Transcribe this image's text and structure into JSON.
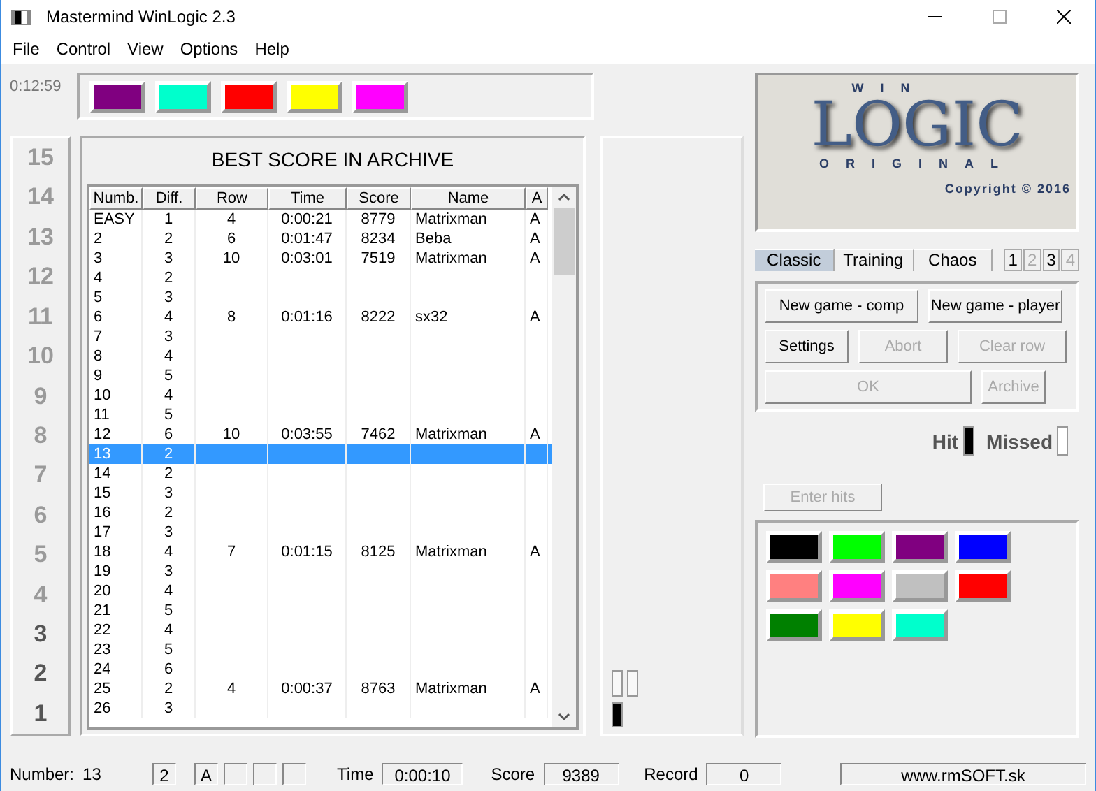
{
  "window": {
    "title": "Mastermind WinLogic 2.3"
  },
  "menu": [
    "File",
    "Control",
    "View",
    "Options",
    "Help"
  ],
  "timer": "0:12:59",
  "code": [
    {
      "color": "#800080"
    },
    {
      "color": "#00ffcc"
    },
    {
      "color": "#ff0000"
    },
    {
      "color": "#ffff00"
    },
    {
      "color": "#ff00ff"
    }
  ],
  "row_numbers": [
    {
      "label": "15",
      "active": false
    },
    {
      "label": "14",
      "active": false
    },
    {
      "label": "13",
      "active": false
    },
    {
      "label": "12",
      "active": false
    },
    {
      "label": "11",
      "active": false
    },
    {
      "label": "10",
      "active": false
    },
    {
      "label": "9",
      "active": false
    },
    {
      "label": "8",
      "active": false
    },
    {
      "label": "7",
      "active": false
    },
    {
      "label": "6",
      "active": false
    },
    {
      "label": "5",
      "active": false
    },
    {
      "label": "4",
      "active": false
    },
    {
      "label": "3",
      "active": true
    },
    {
      "label": "2",
      "active": true
    },
    {
      "label": "1",
      "active": true
    }
  ],
  "archive": {
    "title": "BEST SCORE IN ARCHIVE",
    "columns": [
      "Numb.",
      "Diff.",
      "Row",
      "Time",
      "Score",
      "Name",
      "A"
    ],
    "rows": [
      {
        "cells": [
          "EASY",
          "1",
          "4",
          "0:00:21",
          "8779",
          "Matrixman",
          "A"
        ],
        "selected": false
      },
      {
        "cells": [
          "2",
          "2",
          "6",
          "0:01:47",
          "8234",
          "Beba",
          "A"
        ],
        "selected": false
      },
      {
        "cells": [
          "3",
          "3",
          "10",
          "0:03:01",
          "7519",
          "Matrixman",
          "A"
        ],
        "selected": false
      },
      {
        "cells": [
          "4",
          "2"
        ],
        "selected": false
      },
      {
        "cells": [
          "5",
          "3"
        ],
        "selected": false
      },
      {
        "cells": [
          "6",
          "4",
          "8",
          "0:01:16",
          "8222",
          "sx32",
          "A"
        ],
        "selected": false
      },
      {
        "cells": [
          "7",
          "3"
        ],
        "selected": false
      },
      {
        "cells": [
          "8",
          "4"
        ],
        "selected": false
      },
      {
        "cells": [
          "9",
          "5"
        ],
        "selected": false
      },
      {
        "cells": [
          "10",
          "4"
        ],
        "selected": false
      },
      {
        "cells": [
          "11",
          "5"
        ],
        "selected": false
      },
      {
        "cells": [
          "12",
          "6",
          "10",
          "0:03:55",
          "7462",
          "Matrixman",
          "A"
        ],
        "selected": false
      },
      {
        "cells": [
          "13",
          "2"
        ],
        "selected": true
      },
      {
        "cells": [
          "14",
          "2"
        ],
        "selected": false
      },
      {
        "cells": [
          "15",
          "3"
        ],
        "selected": false
      },
      {
        "cells": [
          "16",
          "2"
        ],
        "selected": false
      },
      {
        "cells": [
          "17",
          "3"
        ],
        "selected": false
      },
      {
        "cells": [
          "18",
          "4",
          "7",
          "0:01:15",
          "8125",
          "Matrixman",
          "A"
        ],
        "selected": false
      },
      {
        "cells": [
          "19",
          "3"
        ],
        "selected": false
      },
      {
        "cells": [
          "20",
          "4"
        ],
        "selected": false
      },
      {
        "cells": [
          "21",
          "5"
        ],
        "selected": false
      },
      {
        "cells": [
          "22",
          "4"
        ],
        "selected": false
      },
      {
        "cells": [
          "23",
          "5"
        ],
        "selected": false
      },
      {
        "cells": [
          "24",
          "6"
        ],
        "selected": false
      },
      {
        "cells": [
          "25",
          "2",
          "4",
          "0:00:37",
          "8763",
          "Matrixman",
          "A"
        ],
        "selected": false
      },
      {
        "cells": [
          "26",
          "3"
        ],
        "selected": false
      }
    ]
  },
  "logo": {
    "top": "WIN",
    "main": "LOGIC",
    "bottom": "ORIGINAL",
    "copyright": "Copyright © 2016"
  },
  "modes": [
    {
      "label": "Classic",
      "selected": true
    },
    {
      "label": "Training",
      "selected": false
    },
    {
      "label": "Chaos",
      "selected": false
    }
  ],
  "levels": [
    {
      "label": "1",
      "disabled": false
    },
    {
      "label": "2",
      "disabled": true
    },
    {
      "label": "3",
      "disabled": false
    },
    {
      "label": "4",
      "disabled": true
    }
  ],
  "buttons": [
    {
      "label": "New game - comp",
      "disabled": false
    },
    {
      "label": "New game - player",
      "disabled": false
    },
    {
      "label": "Settings",
      "disabled": false
    },
    {
      "label": "Abort",
      "disabled": true
    },
    {
      "label": "Clear row",
      "disabled": true
    },
    {
      "label": "OK",
      "disabled": true
    },
    {
      "label": "Archive",
      "disabled": true
    }
  ],
  "hit": {
    "label": "Hit",
    "on": true
  },
  "missed": {
    "label": "Missed",
    "on": false
  },
  "enter_hits": {
    "label": "Enter hits",
    "disabled": true
  },
  "palette": [
    {
      "color": "#000000"
    },
    {
      "color": "#00ff00"
    },
    {
      "color": "#800080"
    },
    {
      "color": "#0000ff"
    },
    {
      "color": "#ff8080"
    },
    {
      "color": "#ff00ff"
    },
    {
      "color": "#c0c0c0"
    },
    {
      "color": "#ff0000"
    },
    {
      "color": "#008000"
    },
    {
      "color": "#ffff00"
    },
    {
      "color": "#00ffcc"
    }
  ],
  "status": {
    "number_label": "Number:",
    "number": "13",
    "fields": [
      "2",
      "A"
    ],
    "time_label": "Time",
    "time": "0:00:10",
    "score_label": "Score",
    "score": "9389",
    "record_label": "Record",
    "record": "0",
    "website": "www.rmSOFT.sk"
  }
}
